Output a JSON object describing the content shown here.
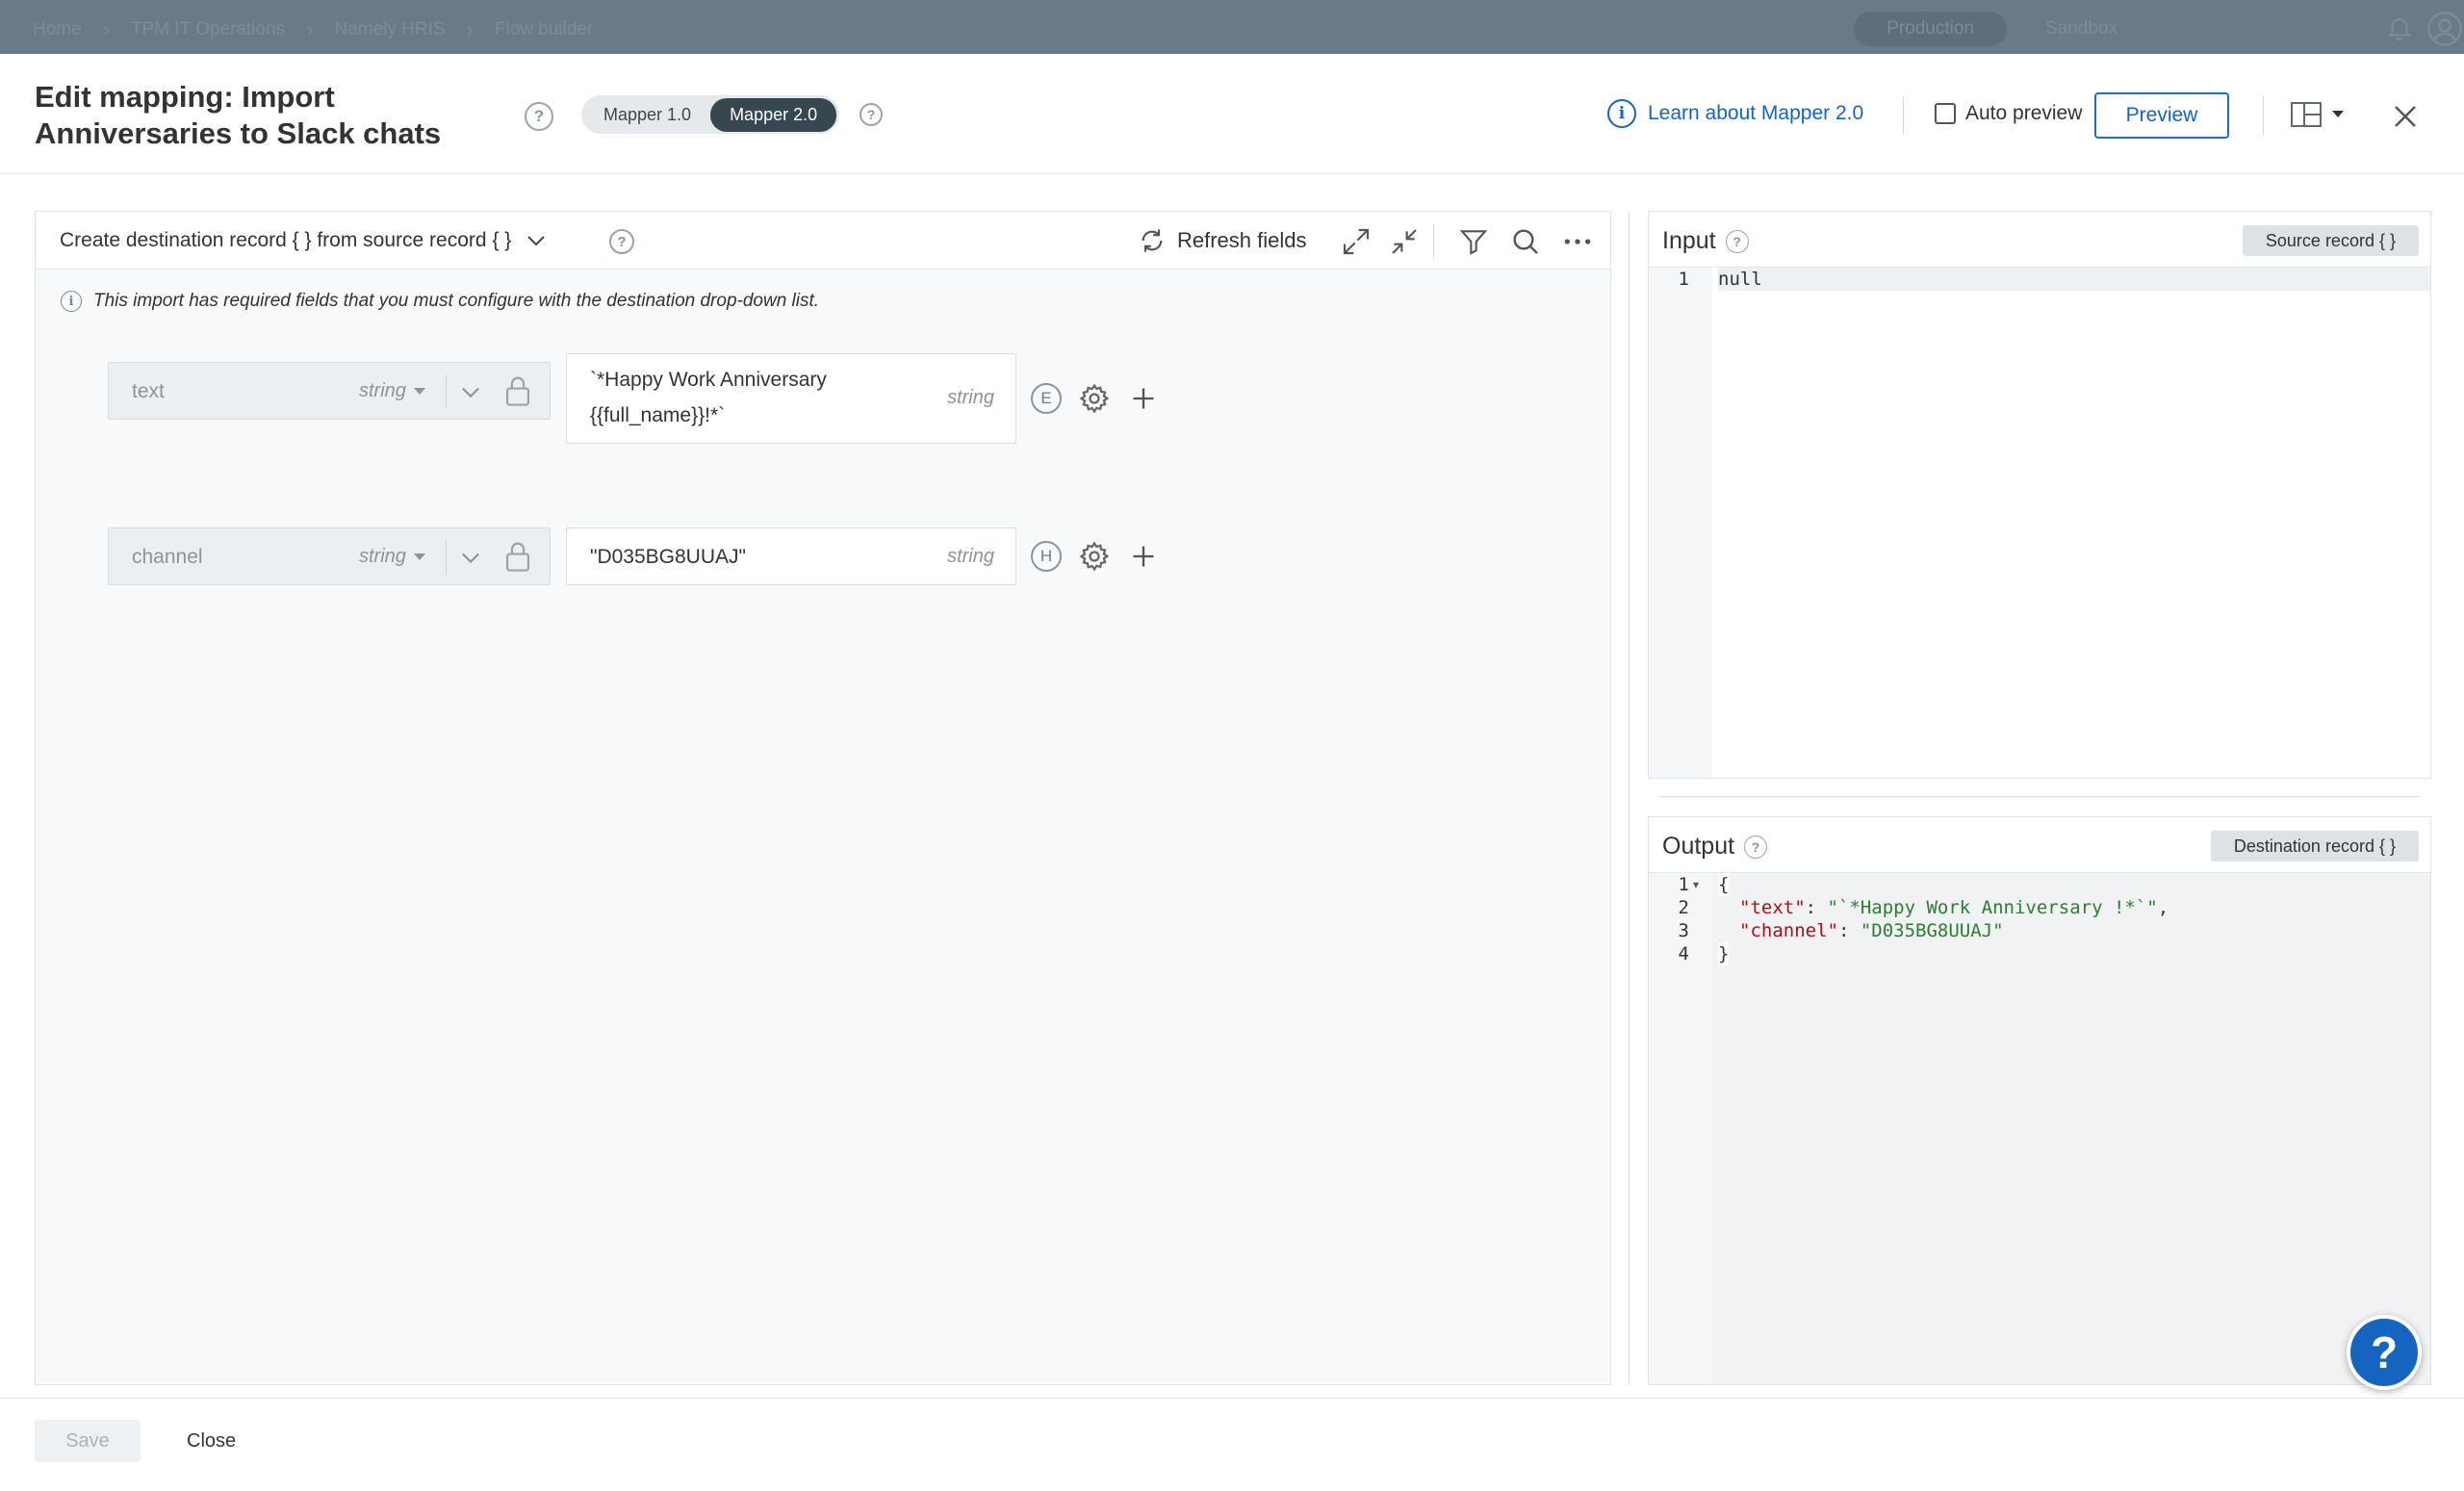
{
  "nav": {
    "breadcrumbs": [
      "Home",
      "TPM IT Operations",
      "Namely HRIS",
      "Flow builder"
    ],
    "env_production": "Production",
    "env_sandbox": "Sandbox"
  },
  "header": {
    "title": "Edit mapping: Import Anniversaries to Slack chats",
    "mapper_options": [
      "Mapper 1.0",
      "Mapper 2.0"
    ],
    "mapper_selected": "Mapper 2.0",
    "help_glyph": "?",
    "learn_link": "Learn about Mapper 2.0",
    "info_glyph": "i",
    "auto_preview_label": "Auto preview",
    "auto_preview_checked": false,
    "preview_button": "Preview"
  },
  "mapping": {
    "create_label": "Create destination record { } from source record { }",
    "refresh_label": "Refresh fields",
    "notice": "This import has required fields that you must configure with the destination drop-down list.",
    "rows": [
      {
        "dest_field": "text",
        "dest_type": "string",
        "source_value_line1": "`*Happy Work Anniversary",
        "source_value_line2": "{{full_name}}!*`",
        "source_type": "string",
        "badge": "E"
      },
      {
        "dest_field": "channel",
        "dest_type": "string",
        "source_value_line1": "\"D035BG8UUAJ\"",
        "source_type": "string",
        "badge": "H"
      }
    ]
  },
  "input_panel": {
    "title": "Input",
    "button": "Source record { }",
    "lines": [
      {
        "n": "1",
        "text": "null"
      }
    ]
  },
  "output_panel": {
    "title": "Output",
    "button": "Destination record { }",
    "line_numbers": [
      "1",
      "2",
      "3",
      "4"
    ],
    "open_brace": "{",
    "text_key": "\"text\"",
    "text_value": "\"`*Happy Work Anniversary !*`\"",
    "channel_key": "\"channel\"",
    "channel_value": "\"D035BG8UUAJ\"",
    "colon": ": ",
    "comma": ",",
    "close_brace": "}"
  },
  "footer": {
    "save": "Save",
    "close": "Close",
    "help_fab": "?"
  },
  "colors": {
    "accent": "#1565c0",
    "toggle_active": "#37474f"
  }
}
